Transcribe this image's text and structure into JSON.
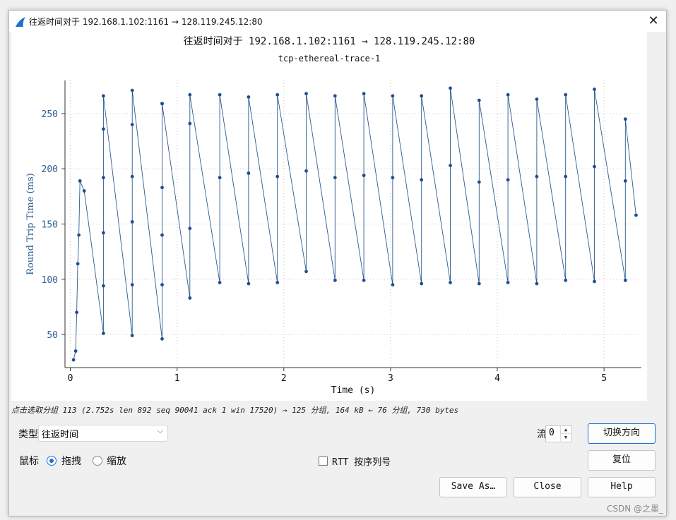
{
  "window": {
    "title": "往返时间对于 192.168.1.102:1161 → 128.119.245.12:80",
    "close_glyph": "✕"
  },
  "plot": {
    "title": "往返时间对于 192.168.1.102:1161 → 128.119.245.12:80",
    "subtitle": "tcp-ethereal-trace-1"
  },
  "chart_data": {
    "type": "line",
    "xlabel": "Time (s)",
    "ylabel": "Round Trip Time (ms)",
    "xlim": [
      -0.05,
      5.35
    ],
    "ylim": [
      20,
      280
    ],
    "xticks": [
      "0",
      "1",
      "2",
      "3",
      "4",
      "5"
    ],
    "yticks": [
      "50",
      "100",
      "150",
      "200",
      "250"
    ],
    "grid": true,
    "line_color": "#2b5a8e",
    "marker_color": "#1f4f8a",
    "highlight_index": 79,
    "series": [
      {
        "x": [
          0.03,
          0.05,
          0.06,
          0.07,
          0.08,
          0.09,
          0.13,
          0.31,
          0.31,
          0.31,
          0.31,
          0.31,
          0.31,
          0.58,
          0.58,
          0.58,
          0.58,
          0.58,
          0.58,
          0.86,
          0.86,
          0.86,
          0.86,
          0.86,
          0.86,
          1.12,
          1.12,
          1.12,
          1.12,
          1.4,
          1.4,
          1.4,
          1.67,
          1.67,
          1.67,
          1.94,
          1.94,
          1.94,
          2.21,
          2.21,
          2.21,
          2.48,
          2.48,
          2.48,
          2.75,
          2.75,
          2.75,
          3.02,
          3.02,
          3.02,
          3.29,
          3.29,
          3.29,
          3.56,
          3.56,
          3.56,
          3.83,
          3.83,
          3.83,
          4.1,
          4.1,
          4.1,
          4.37,
          4.37,
          4.37,
          4.64,
          4.64,
          4.64,
          4.91,
          4.91,
          4.91,
          5.2,
          5.2,
          5.2,
          5.3
        ],
        "y": [
          27,
          35,
          70,
          114,
          140,
          189,
          180,
          51,
          94,
          142,
          192,
          236,
          266,
          49,
          95,
          152,
          193,
          240,
          271,
          46,
          95,
          140,
          183,
          259,
          259,
          83,
          146,
          241,
          267,
          97,
          192,
          267,
          96,
          196,
          265,
          97,
          193,
          267,
          107,
          198,
          268,
          99,
          192,
          266,
          99,
          194,
          268,
          95,
          192,
          266,
          96,
          190,
          266,
          97,
          203,
          273,
          96,
          188,
          262,
          97,
          190,
          267,
          96,
          193,
          263,
          99,
          193,
          267,
          98,
          202,
          272,
          99,
          189,
          245,
          158
        ]
      }
    ]
  },
  "status": {
    "text": "点击选取分组 113 (2.752s len 892 seq 90041 ack 1 win 17520) → 125 分组, 164 kB ← 76 分组, 730 bytes"
  },
  "controls": {
    "type_label": "类型",
    "type_value": "往返时间",
    "flow_label": "流",
    "flow_value": "0",
    "switch_direction": "切换方向",
    "mouse_label": "鼠标",
    "drag_label": "拖拽",
    "zoom_label": "缩放",
    "rtt_label": "RTT 按序列号",
    "reset_label": "复位",
    "save_as": "Save As…",
    "close": "Close",
    "help": "Help"
  },
  "watermark": "CSDN @之墨_"
}
